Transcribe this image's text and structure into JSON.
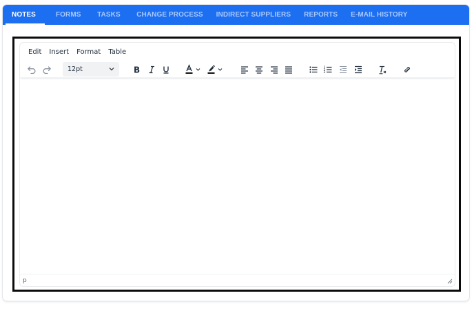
{
  "tabs": [
    {
      "label": "NOTES",
      "active": true
    },
    {
      "label": "FORMS"
    },
    {
      "label": "TASKS"
    },
    {
      "label": "CHANGE PROCESS"
    },
    {
      "label": "INDIRECT SUPPLIERS"
    },
    {
      "label": "REPORTS"
    },
    {
      "label": "E-MAIL HISTORY"
    }
  ],
  "colors": {
    "tab_bar": "#1d6ff2",
    "frame": "#0b0b0b",
    "icon": "#222f3e",
    "disabled_icon": "#8a939e"
  },
  "editor": {
    "menu": {
      "edit": "Edit",
      "insert": "Insert",
      "format": "Format",
      "table": "Table"
    },
    "font_size": "12pt",
    "toolbar_icons": [
      "undo-icon",
      "redo-icon",
      "bold-icon",
      "italic-icon",
      "underline-icon",
      "text-color-icon",
      "highlight-color-icon",
      "align-left-icon",
      "align-center-icon",
      "align-right-icon",
      "align-justify-icon",
      "bullet-list-icon",
      "numbered-list-icon",
      "outdent-icon",
      "indent-icon",
      "clear-formatting-icon",
      "link-icon"
    ],
    "status_path": "p"
  }
}
